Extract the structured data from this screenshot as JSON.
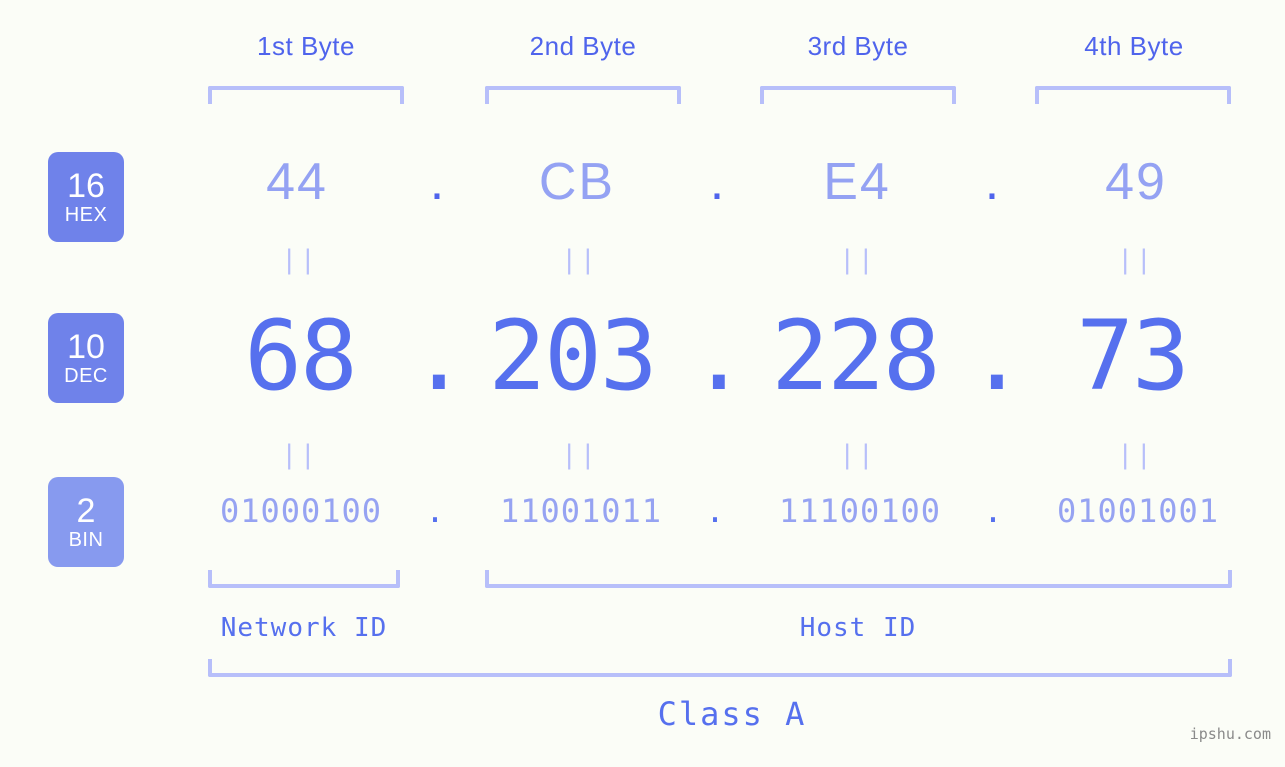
{
  "page": {
    "background_color": "#fbfdf7",
    "accent_color": "#5670ee",
    "light_accent_color": "#b7bffa",
    "badge_color": "#6f82ea",
    "watermark": "ipshu.com"
  },
  "byte_headers": [
    {
      "label": "1st Byte"
    },
    {
      "label": "2nd Byte"
    },
    {
      "label": "3rd Byte"
    },
    {
      "label": "4th Byte"
    }
  ],
  "rows": {
    "hex": {
      "badge_num": "16",
      "badge_sub": "HEX",
      "values": [
        "44",
        "CB",
        "E4",
        "49"
      ],
      "separator": "."
    },
    "dec": {
      "badge_num": "10",
      "badge_sub": "DEC",
      "values": [
        "68",
        "203",
        "228",
        "73"
      ],
      "separator": "."
    },
    "bin": {
      "badge_num": "2",
      "badge_sub": "BIN",
      "values": [
        "01000100",
        "11001011",
        "11100100",
        "01001001"
      ],
      "separator": "."
    }
  },
  "equals_marks": {
    "glyph": "||",
    "count_per_row": 4
  },
  "id_labels": {
    "network": "Network ID",
    "host": "Host ID"
  },
  "class_label": "Class A"
}
